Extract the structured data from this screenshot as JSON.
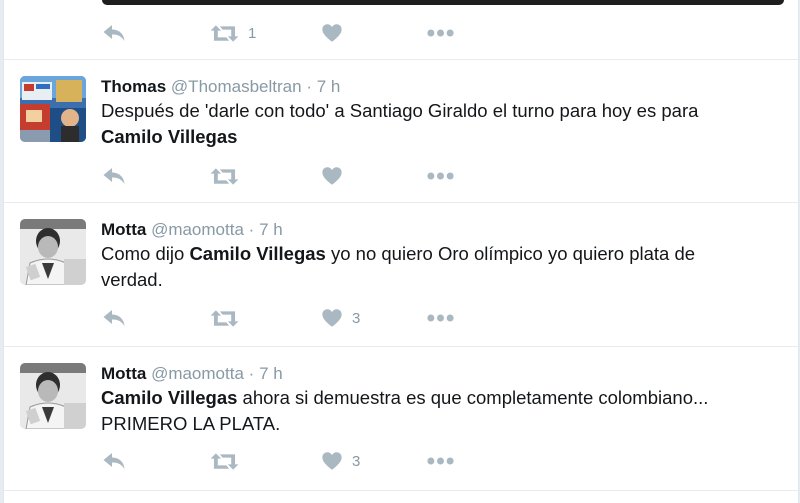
{
  "top_tweet": {
    "retweet_count": "1"
  },
  "tweets": [
    {
      "name": "Thomas",
      "handle": "@Thomasbeltran",
      "sep": "·",
      "time": "7 h",
      "text": {
        "l1": "Después de 'darle con todo' a Santiago Giraldo el turno para hoy es para",
        "l2_bold": "Camilo Villegas"
      }
    },
    {
      "name": "Motta",
      "handle": "@maomotta",
      "sep": "·",
      "time": "7 h",
      "text": {
        "l1_pre": "Como dijo ",
        "l1_bold": "Camilo Villegas",
        "l1_post": " yo no quiero Oro olímpico  yo quiero plata de",
        "l2": "verdad."
      },
      "like_count": "3"
    },
    {
      "name": "Motta",
      "handle": "@maomotta",
      "sep": "·",
      "time": "7 h",
      "text": {
        "l1_bold": "Camilo Villegas",
        "l1_post": " ahora si demuestra es que completamente colombiano...",
        "l2": "PRIMERO LA PLATA."
      },
      "like_count": "3"
    }
  ],
  "icons": {
    "reply": "reply-icon",
    "retweet": "retweet-icon",
    "like": "heart-icon",
    "more": "more-dots-icon"
  },
  "colors": {
    "action_icon": "#aab8c2",
    "muted_text": "#8899a6",
    "divider": "#e6ecf0"
  }
}
